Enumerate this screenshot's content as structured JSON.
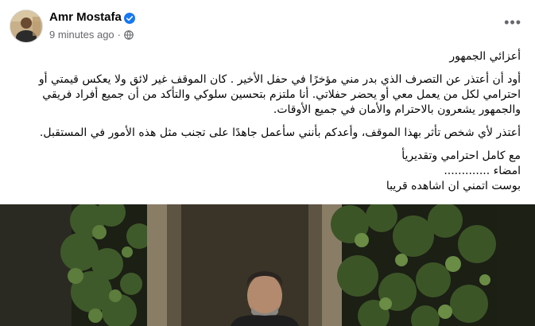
{
  "author": {
    "name": "Amr Mostafa",
    "time": "9 minutes ago",
    "verified": true
  },
  "post": {
    "greeting": "أعزائي الجمهور",
    "p1": "أود أن أعتذر عن التصرف الذي بدر مني مؤخرًا في حفل  الأخير . كان الموقف غير لائق ولا يعكس قيمتي أو احترامي لكل من يعمل معي أو يحضر حفلاتي. أنا ملتزم بتحسين سلوكي والتأكد من أن جميع أفراد فريقي والجمهور يشعرون بالاحترام والأمان في جميع الأوقات.",
    "p2": "أعتذر لأي شخص تأثر بهذا الموقف، وأعدكم بأنني سأعمل جاهدًا على تجنب مثل هذه الأمور في المستقبل.",
    "closing": "مع كامل احترامي وتقديريأ",
    "sign": "امضاء .............",
    "footer": "بوست اتمني ان اشاهده قريبا"
  },
  "colors": {
    "verified": "#1877f2",
    "meta": "#65676b"
  }
}
